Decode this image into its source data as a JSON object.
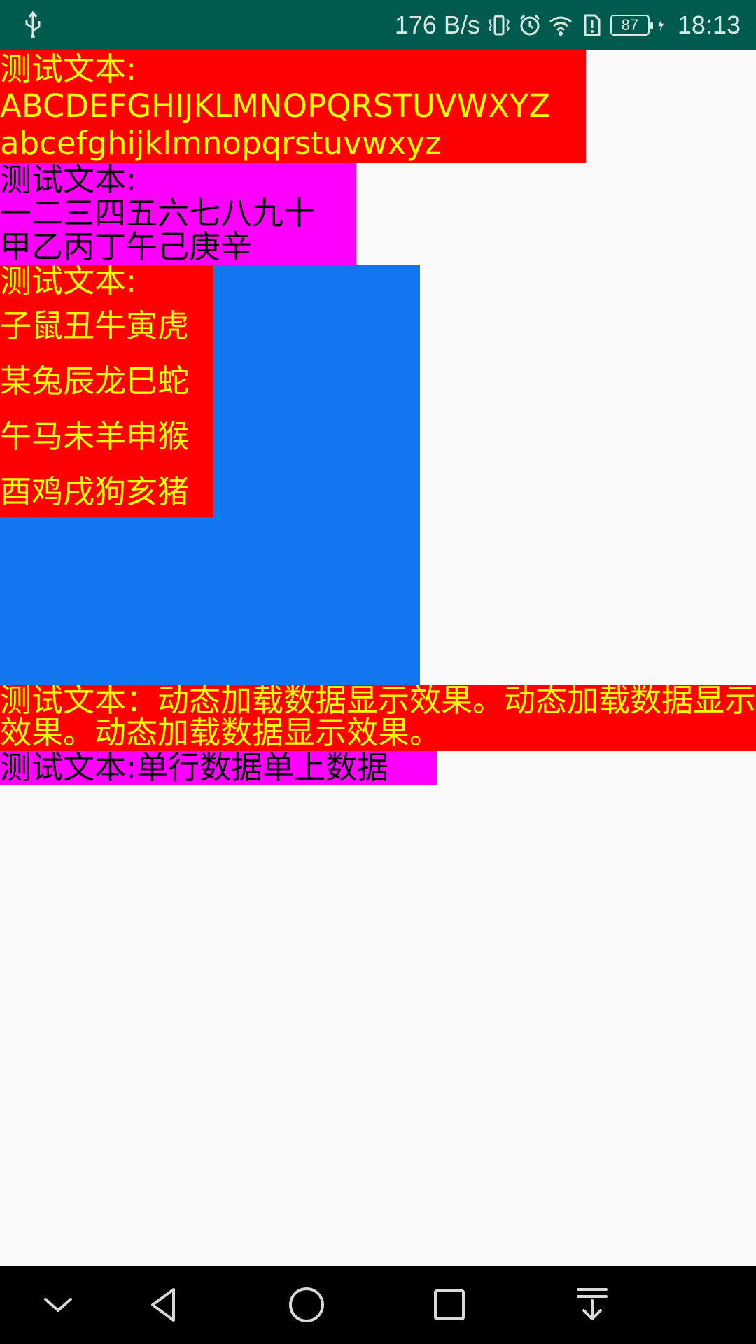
{
  "status_bar": {
    "network_speed": "176 B/s",
    "battery_level": "87",
    "time": "18:13",
    "icons": [
      "usb-icon",
      "vibrate-icon",
      "alarm-icon",
      "wifi-icon",
      "alert-icon",
      "battery-icon",
      "charging-icon"
    ]
  },
  "blocks": [
    {
      "lines": [
        "测试文本:",
        "ABCDEFGHIJKLMNOPQRSTUVWXYZ",
        "abcefghijklmnopqrstuvwxyz"
      ],
      "bg": "#ff0000",
      "fg": "#ffff00"
    },
    {
      "lines": [
        "测试文本:",
        "一二三四五六七八九十",
        "甲乙丙丁午己庚辛"
      ],
      "bg": "#ff00ff",
      "fg": "#000000"
    },
    {
      "lines": [
        "测试文本:",
        "子鼠丑牛寅虎",
        "某兔辰龙巳蛇",
        "午马未羊申猴",
        "酉鸡戌狗亥猪"
      ],
      "bg": "#ff0000",
      "fg": "#ffff00"
    },
    {
      "lines": [
        "测试文本：动态加载数据显示效果。动态加载数据显示效果。动态加载数据显示效果。"
      ],
      "bg": "#ff0000",
      "fg": "#ffff00"
    },
    {
      "lines": [
        "测试文本:单行数据单上数据"
      ],
      "bg": "#ff00ff",
      "fg": "#000000"
    }
  ],
  "colors": {
    "status_bar_bg": "#005a4d",
    "blue_box": "#1276ee",
    "page_bg": "#fafafa",
    "nav_bg": "#000000"
  },
  "nav_bar": {
    "buttons": [
      "chevron-down-icon",
      "back-triangle-icon",
      "home-circle-icon",
      "recents-square-icon",
      "notification-pulldown-icon"
    ]
  }
}
